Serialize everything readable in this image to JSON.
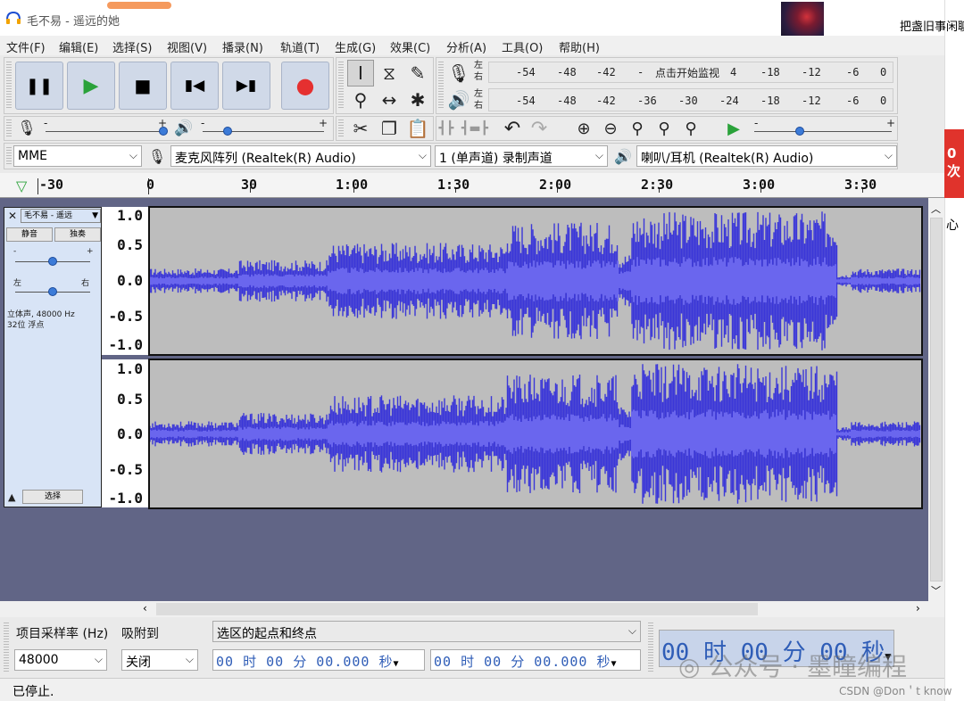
{
  "window": {
    "title": "毛不易 - 遥远的她",
    "side_news": "把盏旧事闲聊",
    "ad_text": "0次",
    "side_char": "心"
  },
  "menu": [
    "文件(F)",
    "编辑(E)",
    "选择(S)",
    "视图(V)",
    "播录(N)",
    "轨道(T)",
    "生成(G)",
    "效果(C)",
    "分析(A)",
    "工具(O)",
    "帮助(H)"
  ],
  "meters": {
    "rec_scale": [
      "-54",
      "-48",
      "-42",
      "-",
      "点击开始监视",
      "4",
      "-18",
      "-12",
      "-6",
      "0"
    ],
    "play_scale": [
      "-54",
      "-48",
      "-42",
      "-36",
      "-30",
      "-24",
      "-18",
      "-12",
      "-6",
      "0"
    ],
    "left": "左",
    "right": "右",
    "plus": "+",
    "minus": "-"
  },
  "devices": {
    "host": "MME",
    "input": "麦克风阵列 (Realtek(R) Audio)",
    "channels": "1 (单声道) 录制声道",
    "output": "喇叭/耳机 (Realtek(R) Audio)"
  },
  "ruler": [
    "-30",
    "0",
    "30",
    "1:00",
    "1:30",
    "2:00",
    "2:30",
    "3:00",
    "3:30"
  ],
  "track": {
    "name": "毛不易 - 遥远",
    "mute": "静音",
    "solo": "独奏",
    "left": "左",
    "right": "右",
    "plus": "+",
    "minus": "-",
    "info1": "立体声, 48000 Hz",
    "info2": "32位 浮点",
    "select": "选择",
    "scale": [
      "1.0",
      "0.5",
      "0.0",
      "-0.5",
      "-1.0"
    ]
  },
  "selection_bar": {
    "rate_label": "项目采样率 (Hz)",
    "snap_label": "吸附到",
    "mode": "选区的起点和终点",
    "rate": "48000",
    "snap": "关闭",
    "start": "00 时 00 分 00.000 秒",
    "end": "00 时 00 分 00.000 秒",
    "audio_pos": "00 时 00 分 00 秒"
  },
  "status": "已停止.",
  "watermark": "公众号 · 墨瞳编程",
  "csdn": "CSDN @Don＇t know",
  "colors": {
    "wave": "#3b37d8",
    "track_bg": "#616586",
    "wave_bg": "#bdbdbd",
    "panel": "#d8e4f6",
    "time_text": "#2f5db7"
  }
}
